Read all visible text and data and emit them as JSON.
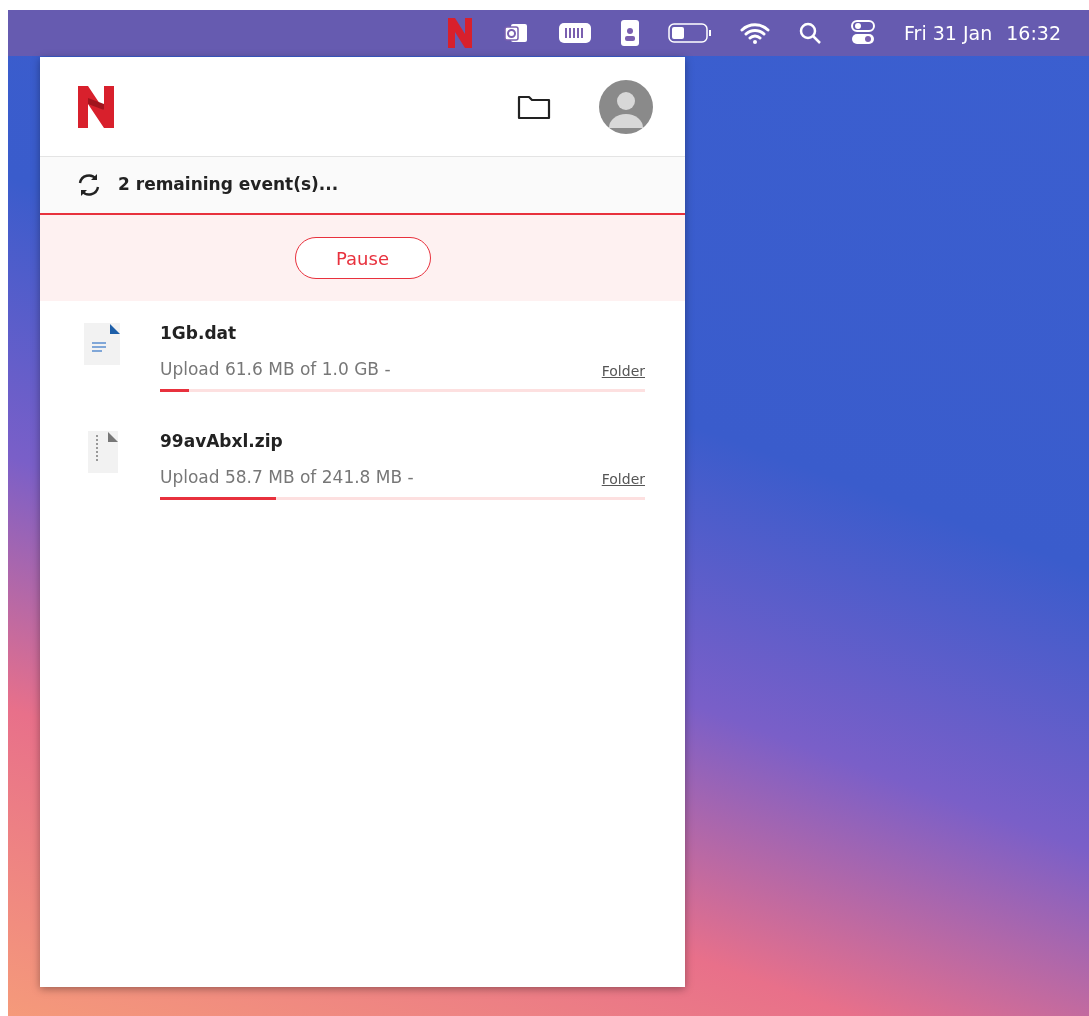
{
  "menu_bar": {
    "date": "Fri 31 Jan",
    "time": "16:32"
  },
  "panel": {
    "status": {
      "text": "2 remaining event(s)..."
    },
    "pause_button": {
      "label": "Pause"
    },
    "transfers": [
      {
        "kind": "document",
        "name": "1Gb.dat",
        "progress_text": "Upload 61.6 MB of 1.0 GB -",
        "link": "Folder",
        "level": 0.06
      },
      {
        "kind": "archive",
        "name": "99avAbxl.zip",
        "progress_text": "Upload 58.7 MB of 241.8 MB -",
        "link": "Folder",
        "level": 0.24
      }
    ]
  }
}
